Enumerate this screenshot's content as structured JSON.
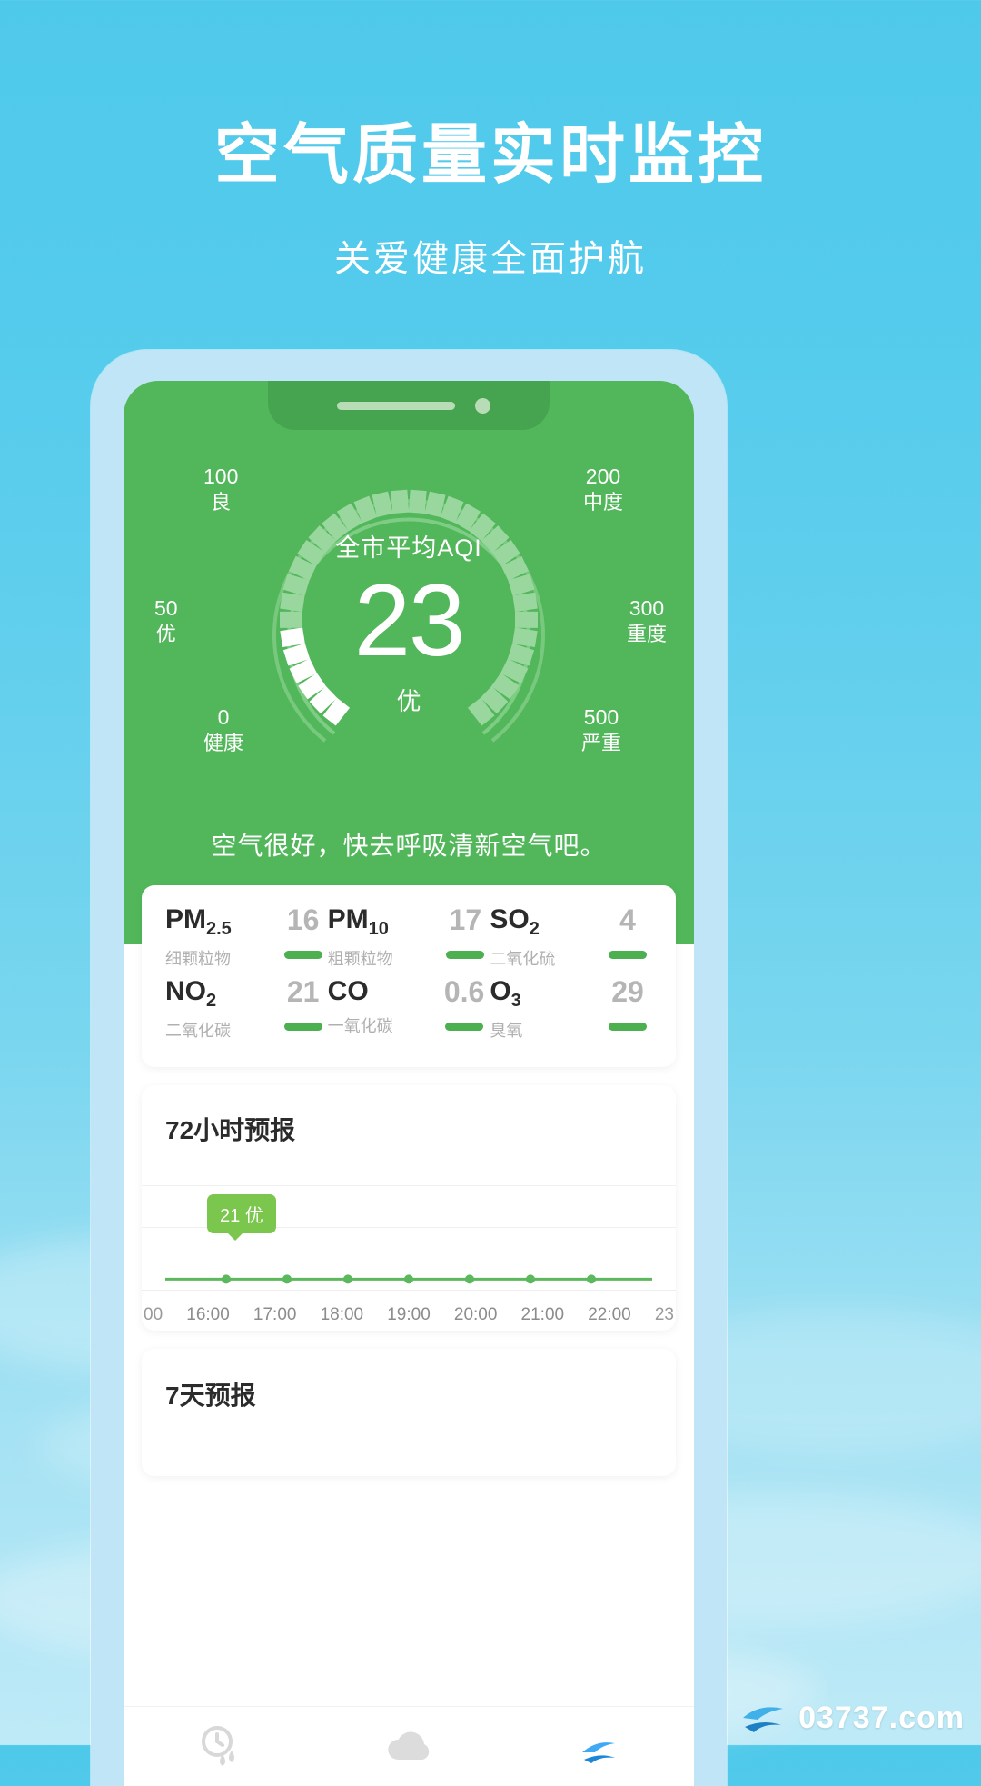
{
  "promo": {
    "headline": "空气质量实时监控",
    "subhead": "关爱健康全面护航"
  },
  "colors": {
    "page_bg_top": "#4fc9ea",
    "page_bg_bottom": "#bfeaf7",
    "aqi_green": "#52b75a",
    "accent_green": "#4caf50",
    "tooltip_green": "#7bc74d"
  },
  "app": {
    "gauge": {
      "title": "全市平均AQI",
      "value": "23",
      "level": "优",
      "advice": "空气很好，快去呼吸清新空气吧。",
      "ticks": [
        {
          "value": "100",
          "label": "良"
        },
        {
          "value": "200",
          "label": "中度"
        },
        {
          "value": "50",
          "label": "优"
        },
        {
          "value": "300",
          "label": "重度"
        },
        {
          "value": "0",
          "label": "健康"
        },
        {
          "value": "500",
          "label": "严重"
        }
      ]
    },
    "pollutants": [
      {
        "name": "PM",
        "sub_script": "2.5",
        "cn": "细颗粒物",
        "value": "16"
      },
      {
        "name": "PM",
        "sub_script": "10",
        "cn": "粗颗粒物",
        "value": "17"
      },
      {
        "name": "SO",
        "sub_script": "2",
        "cn": "二氧化硫",
        "value": "4"
      },
      {
        "name": "NO",
        "sub_script": "2",
        "cn": "二氧化碳",
        "value": "21"
      },
      {
        "name": "CO",
        "sub_script": "",
        "cn": "一氧化碳",
        "value": "0.6"
      },
      {
        "name": "O",
        "sub_script": "3",
        "cn": "臭氧",
        "value": "29"
      }
    ],
    "forecast_72h": {
      "title": "72小时预报",
      "tooltip": "21 优"
    },
    "forecast_7d": {
      "title": "7天预报"
    },
    "nav": [
      {
        "icon": "clock-rain-icon",
        "label": ""
      },
      {
        "icon": "cloud-icon",
        "label": ""
      },
      {
        "icon": "logo-icon",
        "label": ""
      }
    ]
  },
  "chart_data": {
    "type": "line",
    "title": "72小时预报",
    "xlabel": "",
    "ylabel": "AQI",
    "x": [
      "00",
      "16:00",
      "17:00",
      "18:00",
      "19:00",
      "20:00",
      "21:00",
      "22:00",
      "23"
    ],
    "series": [
      {
        "name": "AQI",
        "values": [
          21,
          21,
          21,
          21,
          21,
          21,
          21,
          21,
          21
        ]
      }
    ],
    "ylim": [
      0,
      50
    ],
    "grid": true,
    "legend": "none",
    "annotations": [
      {
        "text": "21 优",
        "x": "16:00",
        "y": 21
      }
    ]
  },
  "watermark": {
    "text": "03737.com"
  }
}
